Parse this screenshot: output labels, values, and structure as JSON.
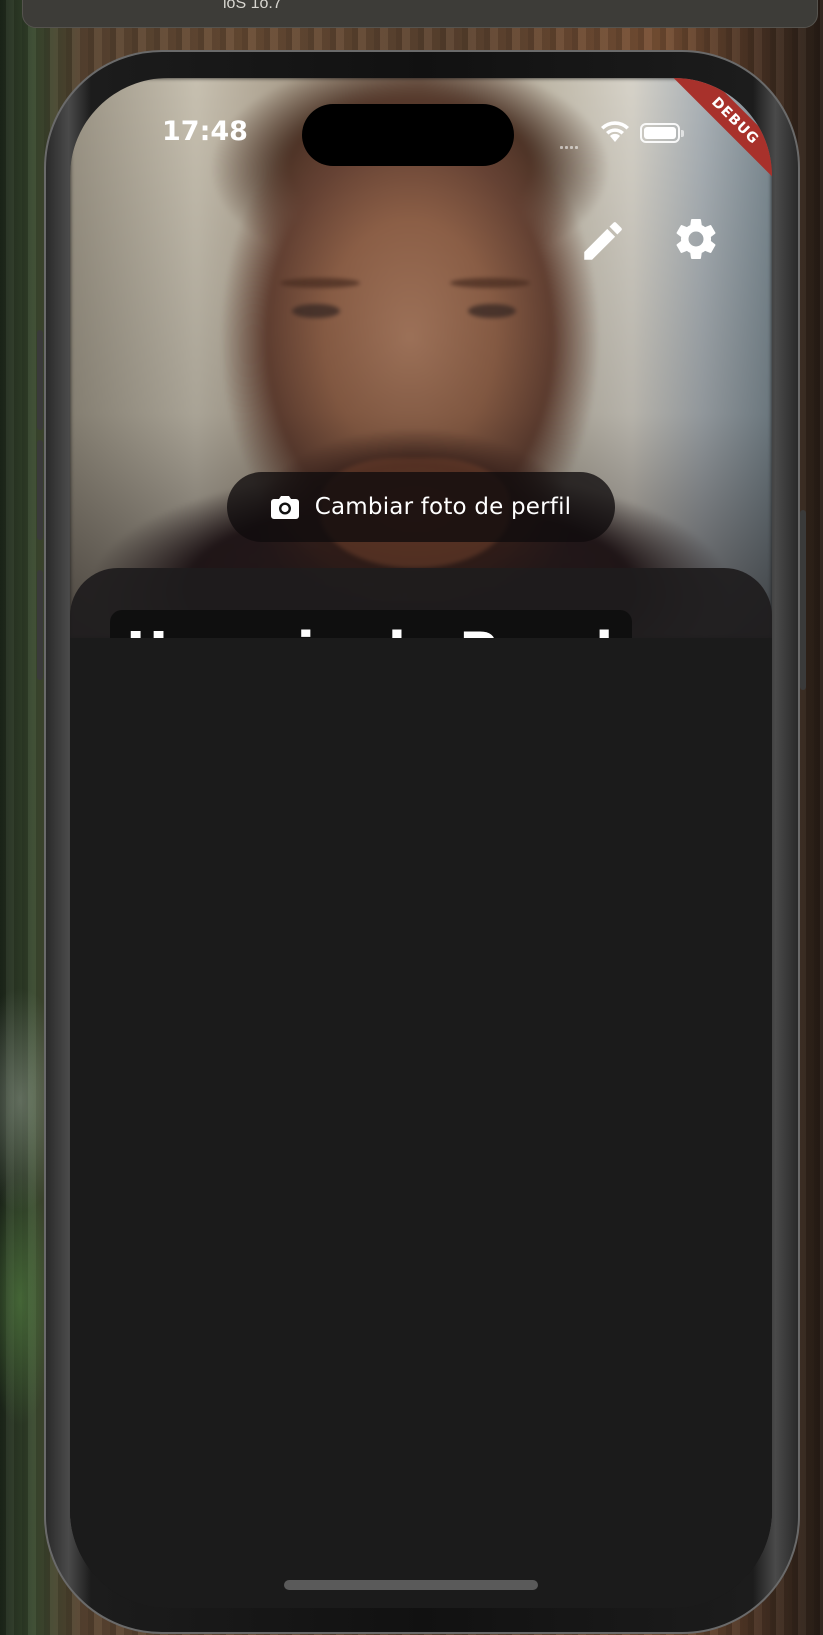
{
  "desktop": {
    "banner_text": "ióS 1o.7"
  },
  "status_bar": {
    "time": "17:48"
  },
  "debug_banner": "DEBUG",
  "header": {
    "edit_icon": "pencil-icon",
    "settings_icon": "gear-icon"
  },
  "profile": {
    "change_photo_label": "Cambiar foto de perfil",
    "change_photo_icon": "camera-icon",
    "name": "Usuario de Prueba"
  },
  "colors": {
    "sheet_background": "#1b1b1b",
    "debug_ribbon": "#a8312b",
    "pill_background": "#0f0c0d"
  }
}
